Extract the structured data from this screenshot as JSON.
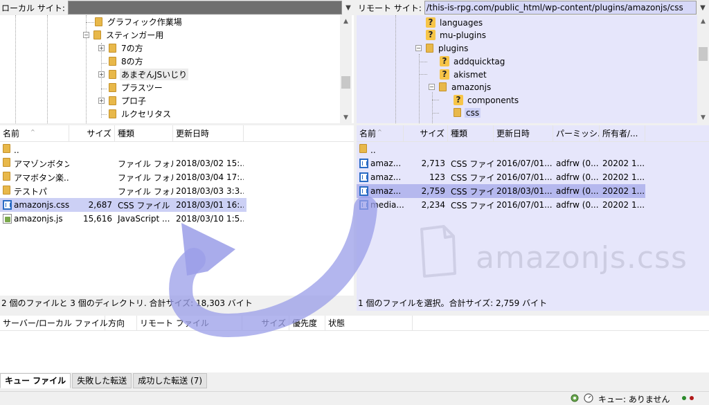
{
  "local": {
    "site_label": "ローカル サイト:",
    "site_value": "",
    "tree": [
      {
        "label": "グラフィック作業場",
        "icon": "folder"
      },
      {
        "label": "スティンガー用",
        "icon": "folder",
        "expander": "−"
      },
      {
        "label": "7の方",
        "icon": "folder",
        "expander": "+"
      },
      {
        "label": "8の方",
        "icon": "folder"
      },
      {
        "label": "あまぞんJSいじり",
        "icon": "folder",
        "expander": "+"
      },
      {
        "label": "プラスツー",
        "icon": "folder"
      },
      {
        "label": "プロ子",
        "icon": "folder",
        "expander": "+"
      },
      {
        "label": "ルクセリタス",
        "icon": "folder"
      }
    ],
    "columns": [
      "名前",
      "サイズ",
      "種類",
      "更新日時"
    ],
    "rows": [
      {
        "name": "..",
        "size": "",
        "type": "",
        "date": "",
        "icon": "folder"
      },
      {
        "name": "アマゾンボタン...",
        "size": "",
        "type": "ファイル フォル...",
        "date": "2018/03/02 15:...",
        "icon": "folder"
      },
      {
        "name": "アマボタン楽...",
        "size": "",
        "type": "ファイル フォル...",
        "date": "2018/03/04 17:...",
        "icon": "folder"
      },
      {
        "name": "テストパ",
        "size": "",
        "type": "ファイル フォル...",
        "date": "2018/03/03 3:3...",
        "icon": "folder"
      },
      {
        "name": "amazonjs.css",
        "size": "2,687",
        "type": "CSS ファイル",
        "date": "2018/03/01 16:...",
        "icon": "css",
        "selected": true
      },
      {
        "name": "amazonjs.js",
        "size": "15,616",
        "type": "JavaScript ...",
        "date": "2018/03/10 1:5...",
        "icon": "js"
      }
    ],
    "status": "2 個のファイルと 3 個のディレクトリ. 合計サイズ: 18,303 バイト"
  },
  "remote": {
    "site_label": "リモート サイト:",
    "site_value": "/this-is-rpg.com/public_html/wp-content/plugins/amazonjs/css",
    "tree": [
      {
        "label": "languages",
        "icon": "question"
      },
      {
        "label": "mu-plugins",
        "icon": "question"
      },
      {
        "label": "plugins",
        "icon": "folder",
        "expander": "−"
      },
      {
        "label": "addquicktag",
        "icon": "question"
      },
      {
        "label": "akismet",
        "icon": "question"
      },
      {
        "label": "amazonjs",
        "icon": "folder",
        "expander": "−"
      },
      {
        "label": "components",
        "icon": "question"
      },
      {
        "label": "css",
        "icon": "folder"
      }
    ],
    "columns": [
      "名前",
      "サイズ",
      "種類",
      "更新日時",
      "パーミッシ...",
      "所有者/..."
    ],
    "rows": [
      {
        "name": "..",
        "size": "",
        "type": "",
        "date": "",
        "perm": "",
        "owner": "",
        "icon": "folder"
      },
      {
        "name": "amaz...",
        "size": "2,713",
        "type": "CSS ファイ...",
        "date": "2016/07/01...",
        "perm": "adfrw (0...",
        "owner": "20202 1...",
        "icon": "css"
      },
      {
        "name": "amaz...",
        "size": "123",
        "type": "CSS ファイ...",
        "date": "2016/07/01...",
        "perm": "adfrw (0...",
        "owner": "20202 1...",
        "icon": "css"
      },
      {
        "name": "amaz...",
        "size": "2,759",
        "type": "CSS ファイ...",
        "date": "2018/03/01...",
        "perm": "adfrw (0...",
        "owner": "20202 1...",
        "icon": "css",
        "selected": true
      },
      {
        "name": "media...",
        "size": "2,234",
        "type": "CSS ファイ...",
        "date": "2016/07/01...",
        "perm": "adfrw (0...",
        "owner": "20202 1...",
        "icon": "css"
      }
    ],
    "status": "1 個のファイルを選択。合計サイズ: 2,759 バイト",
    "watermark": "amazonjs.css"
  },
  "queue": {
    "columns": [
      "サーバー/ローカル ファイル",
      "方向",
      "リモート ファイル",
      "サイズ",
      "優先度",
      "状態"
    ],
    "tabs": [
      "キュー ファイル",
      "失敗した転送",
      "成功した転送 (7)"
    ],
    "status_text": "キュー: ありません"
  },
  "icons": {
    "folder": "folder-icon",
    "question": "unknown-folder-icon",
    "css": "css-file-icon",
    "js": "js-file-icon"
  },
  "colors": {
    "remote_bg": "#e6e6fb",
    "selection": "#ccd0f5",
    "arrow": "#9a9ee8"
  }
}
